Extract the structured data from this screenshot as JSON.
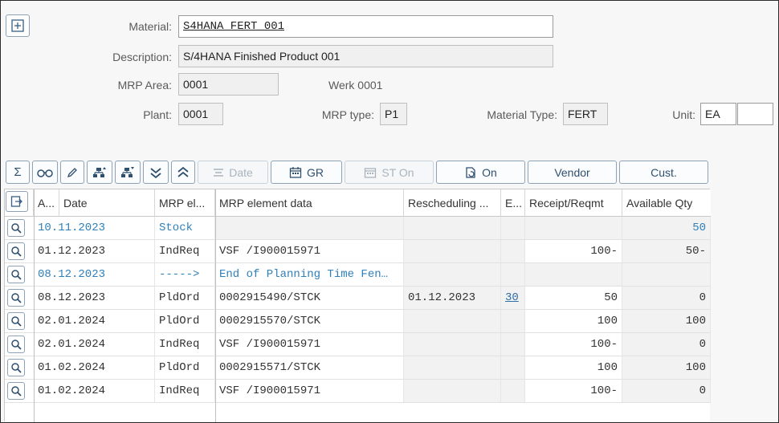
{
  "header": {
    "material_label": "Material:",
    "material_value": "S4HANA_FERT_001",
    "description_label": "Description:",
    "description_value": "S/4HANA Finished Product 001",
    "mrp_area_label": "MRP Area:",
    "mrp_area_value": "0001",
    "werk_text": "Werk 0001",
    "plant_label": "Plant:",
    "plant_value": "0001",
    "mrp_type_label": "MRP type:",
    "mrp_type_value": "P1",
    "material_type_label": "Material Type:",
    "material_type_value": "FERT",
    "unit_label": "Unit:",
    "unit_value": "EA",
    "unit_extra_value": ""
  },
  "toolbar": {
    "date_label": "Date",
    "gr_label": "GR",
    "st_on_label": "ST On",
    "on_label": "On",
    "vendor_label": "Vendor",
    "cust_label": "Cust."
  },
  "columns": [
    "A...",
    "Date",
    "MRP el...",
    "MRP element data",
    "Rescheduling ...",
    "E...",
    "Receipt/Reqmt",
    "Available Qty"
  ],
  "rows": [
    {
      "date": "10.11.2023",
      "mrp_el": "Stock",
      "data": "",
      "resched": "",
      "e": "",
      "receipt": "",
      "available": "50"
    },
    {
      "date": "01.12.2023",
      "mrp_el": "IndReq",
      "data": "VSF /I900015971",
      "resched": "",
      "e": "",
      "receipt": "100-",
      "available": "50-"
    },
    {
      "date": "08.12.2023",
      "mrp_el": "----->",
      "data": "End of Planning Time Fen…",
      "resched": "",
      "e": "",
      "receipt": "",
      "available": ""
    },
    {
      "date": "08.12.2023",
      "mrp_el": "PldOrd",
      "data": "0002915490/STCK",
      "resched": "01.12.2023",
      "e": "30",
      "receipt": "50",
      "available": "0"
    },
    {
      "date": "02.01.2024",
      "mrp_el": "PldOrd",
      "data": "0002915570/STCK",
      "resched": "",
      "e": "",
      "receipt": "100",
      "available": "100"
    },
    {
      "date": "02.01.2024",
      "mrp_el": "IndReq",
      "data": "VSF /I900015971",
      "resched": "",
      "e": "",
      "receipt": "100-",
      "available": "0"
    },
    {
      "date": "01.02.2024",
      "mrp_el": "PldOrd",
      "data": "0002915571/STCK",
      "resched": "",
      "e": "",
      "receipt": "100",
      "available": "100"
    },
    {
      "date": "01.02.2024",
      "mrp_el": "IndReq",
      "data": "VSF /I900015971",
      "resched": "",
      "e": "",
      "receipt": "100-",
      "available": "0"
    }
  ],
  "colors": {
    "accent": "#2f7fb8",
    "button_border": "#8ea2b7",
    "shade": "#f2f2f2"
  }
}
